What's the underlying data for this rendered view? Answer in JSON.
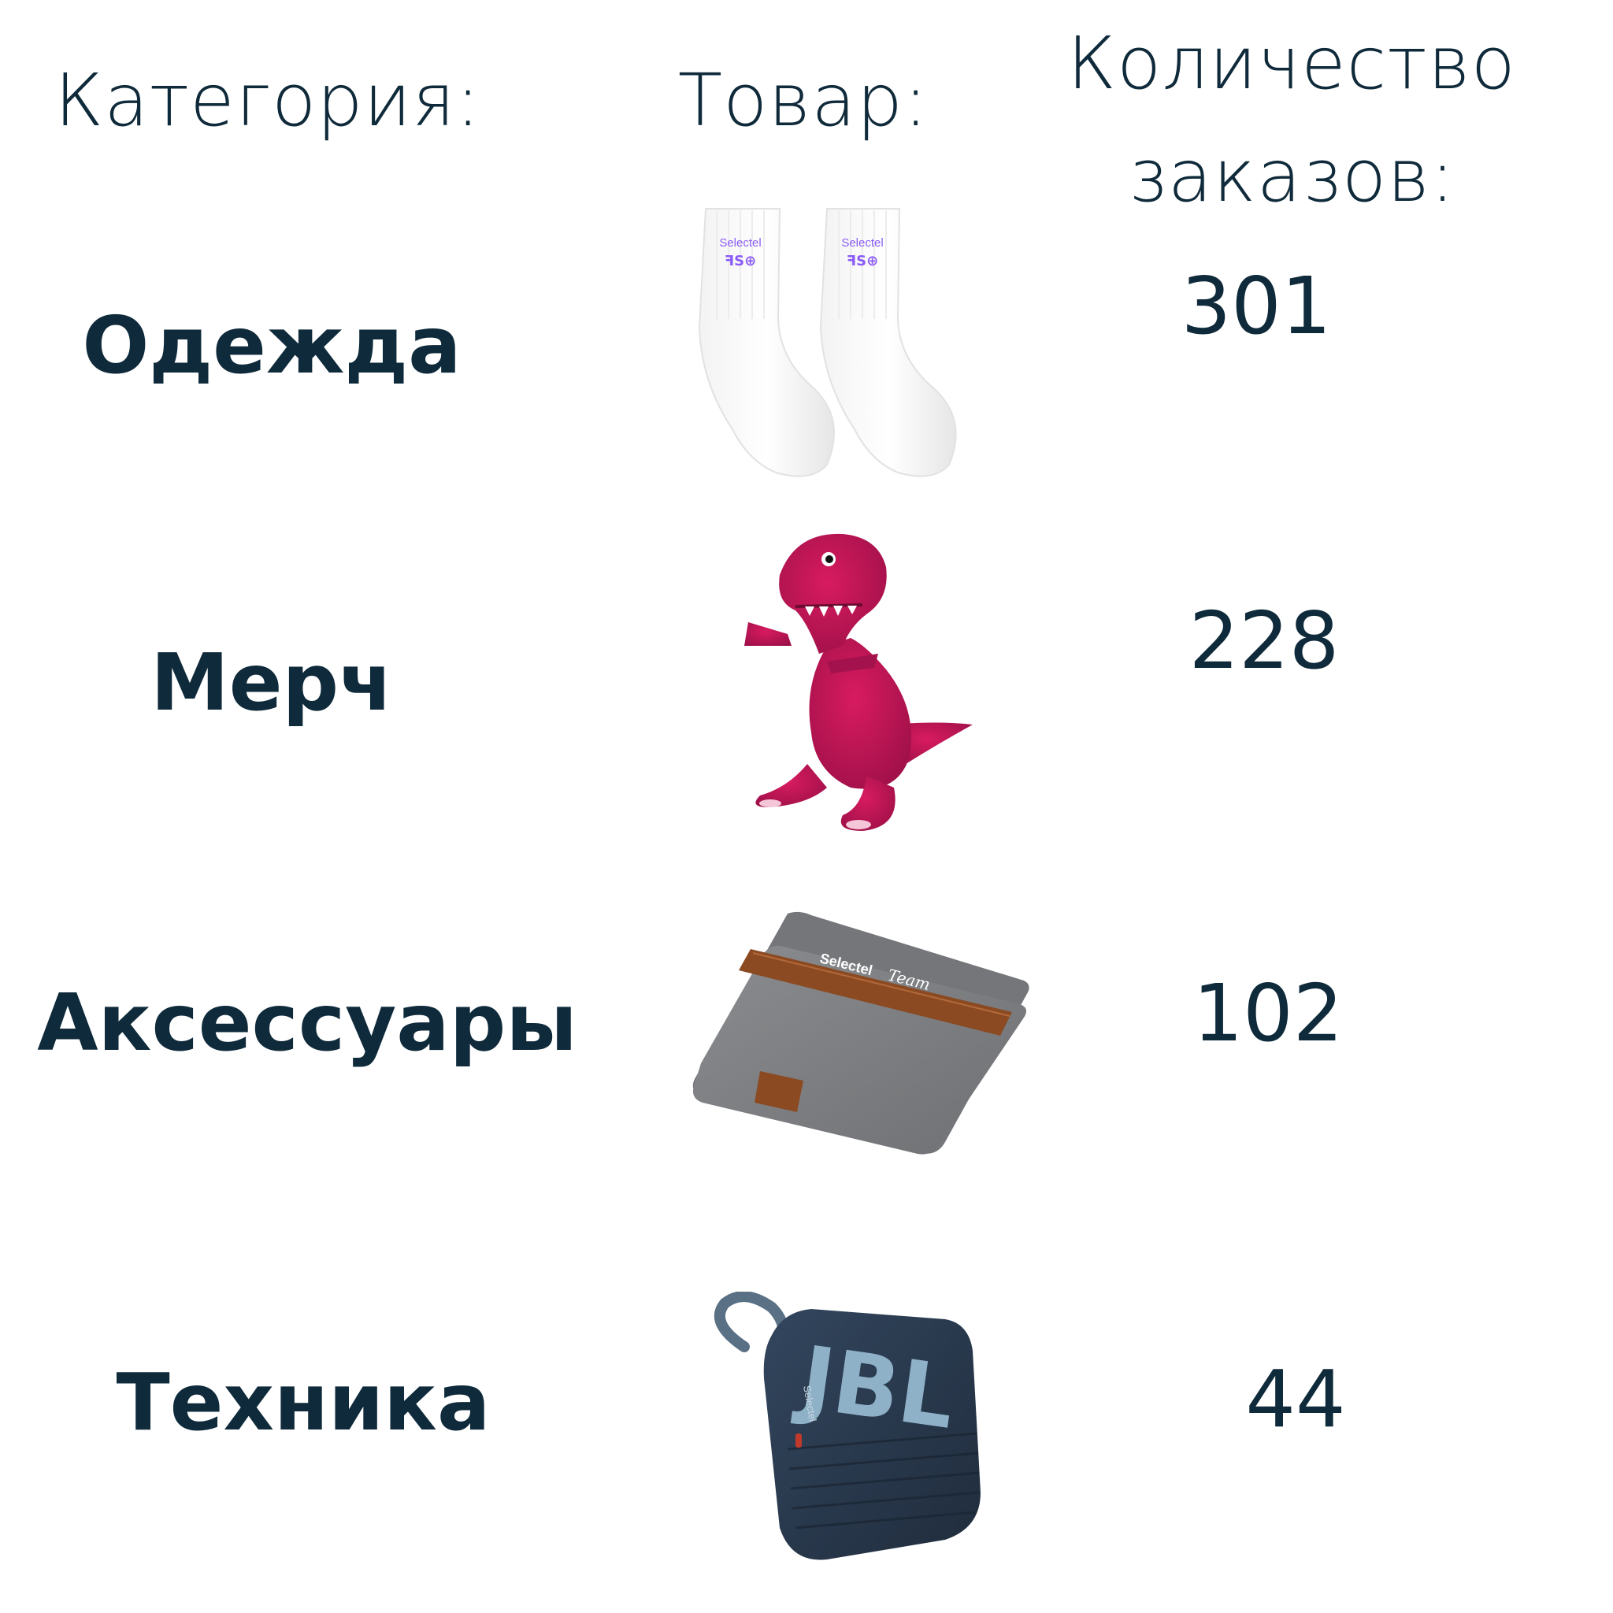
{
  "headers": {
    "category": "Категория:",
    "product": "Товар:",
    "orders_line1": "Количество",
    "orders_line2": "заказов:"
  },
  "rows": [
    {
      "category": "Одежда",
      "orders": "301",
      "product_icon": "socks-icon",
      "logo_text": "Selectel",
      "logo_symbols": "ꟻS⊕"
    },
    {
      "category": "Мерч",
      "orders": "228",
      "product_icon": "dinosaur-plush-icon"
    },
    {
      "category": "Аксессуары",
      "orders": "102",
      "product_icon": "laptop-sleeve-icon",
      "logo_text": "Selectel",
      "logo_script": "Team"
    },
    {
      "category": "Техника",
      "orders": "44",
      "product_icon": "speaker-icon",
      "brand_text": "JBL",
      "logo_text": "Selectel"
    }
  ],
  "colors": {
    "text": "#0f2a3a",
    "sock_logo": "#8b5cf6",
    "dino": "#c2185b",
    "sleeve": "#7d7f82",
    "strap": "#8b4a22",
    "speaker": "#2a3a4e",
    "speaker_logo": "#8fb1c8"
  }
}
